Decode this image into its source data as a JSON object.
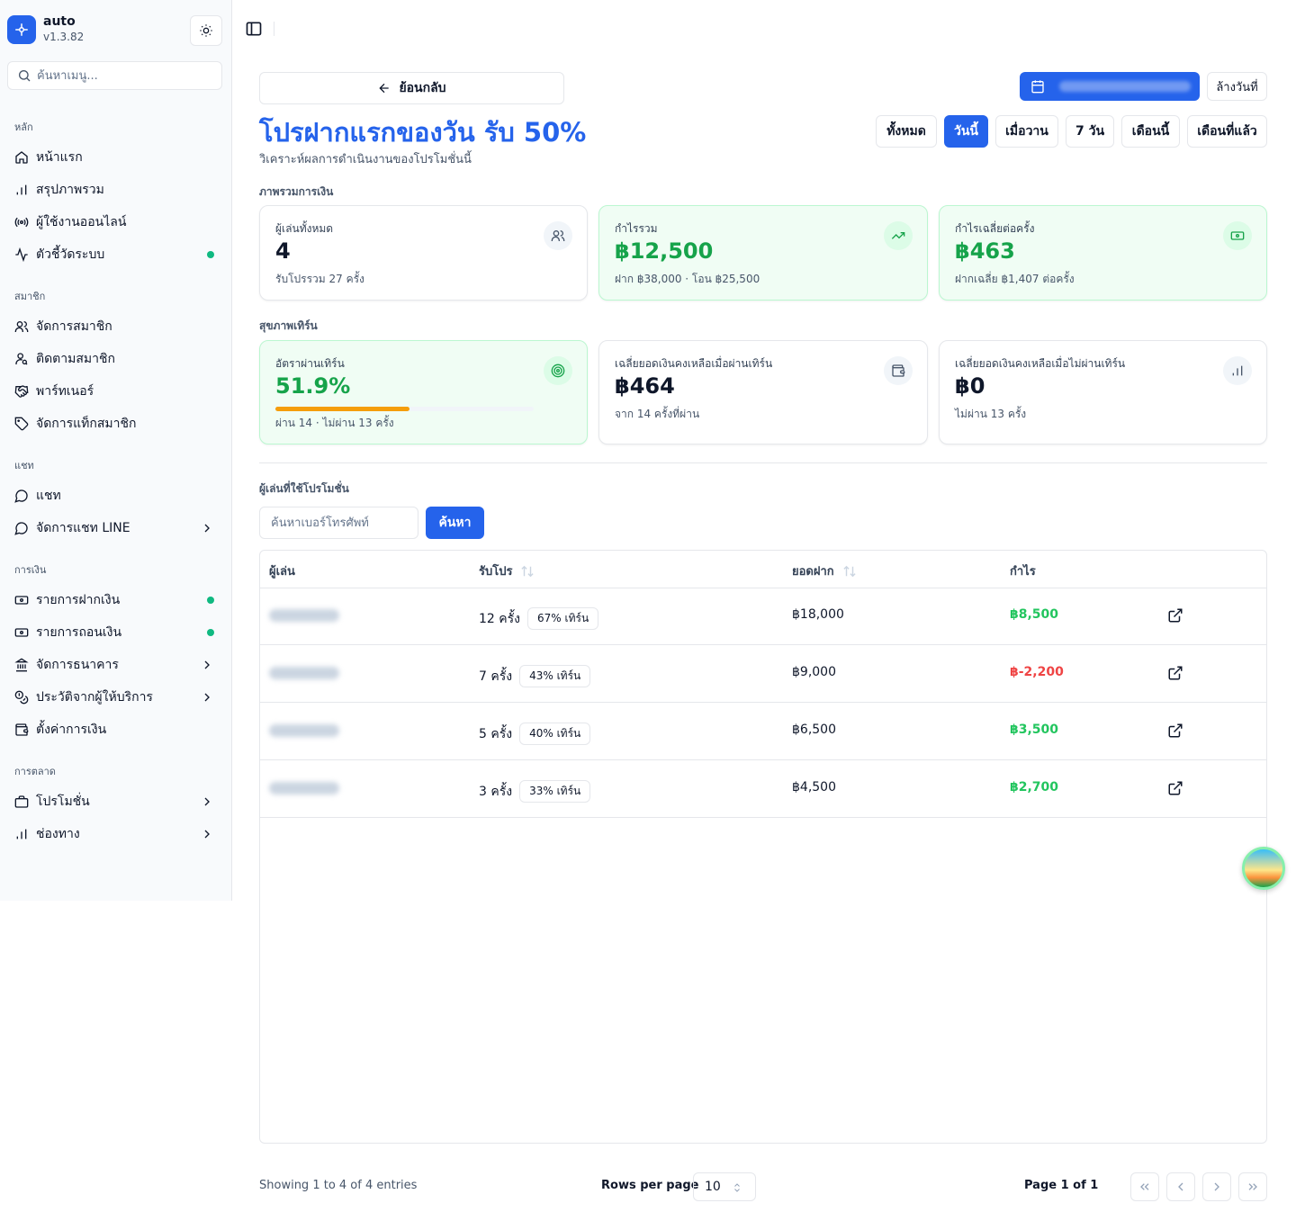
{
  "app": {
    "name": "auto",
    "version": "v1.3.82"
  },
  "sidebar": {
    "search_placeholder": "ค้นหาเมนู...",
    "groups": [
      {
        "label": "หลัก",
        "items": [
          {
            "label": "หน้าแรก",
            "icon": "home-icon"
          },
          {
            "label": "สรุปภาพรวม",
            "icon": "bar-chart-icon"
          },
          {
            "label": "ผู้ใช้งานออนไลน์",
            "icon": "radio-icon"
          },
          {
            "label": "ตัวชี้วัดระบบ",
            "icon": "activity-icon",
            "status_dot": true
          }
        ]
      },
      {
        "label": "สมาชิก",
        "items": [
          {
            "label": "จัดการสมาชิก",
            "icon": "users-icon"
          },
          {
            "label": "ติดตามสมาชิก",
            "icon": "user-search-icon"
          },
          {
            "label": "พาร์ทเนอร์",
            "icon": "handshake-icon"
          },
          {
            "label": "จัดการแท็กสมาชิก",
            "icon": "tag-icon"
          }
        ]
      },
      {
        "label": "แชท",
        "items": [
          {
            "label": "แชท",
            "icon": "message-circle-icon"
          },
          {
            "label": "จัดการแชท LINE",
            "icon": "message-circle-icon",
            "chevron": true
          }
        ]
      },
      {
        "label": "การเงิน",
        "items": [
          {
            "label": "รายการฝากเงิน",
            "icon": "deposit-icon",
            "status_dot": true
          },
          {
            "label": "รายการถอนเงิน",
            "icon": "withdraw-icon",
            "status_dot": true
          },
          {
            "label": "จัดการธนาคาร",
            "icon": "bank-icon",
            "chevron": true
          },
          {
            "label": "ประวัติจากผู้ให้บริการ",
            "icon": "coins-icon",
            "chevron": true
          },
          {
            "label": "ตั้งค่าการเงิน",
            "icon": "wallet-icon"
          }
        ]
      },
      {
        "label": "การตลาด",
        "items": [
          {
            "label": "โปรโมชั่น",
            "icon": "briefcase-icon",
            "chevron": true
          },
          {
            "label": "ช่องทาง",
            "icon": "bar-chart-icon",
            "chevron": true
          }
        ]
      }
    ]
  },
  "header": {
    "back_label": "ย้อนกลับ",
    "clear_date_label": "ล้างวันที่",
    "title": "โปรฝากแรกของวัน รับ 50%",
    "subtitle": "วิเคราะห์ผลการดำเนินงานของโปรโมชั่นนี้",
    "ranges": [
      "ทั้งหมด",
      "วันนี้",
      "เมื่อวาน",
      "7 วัน",
      "เดือนนี้",
      "เดือนที่แล้ว"
    ],
    "active_range": "วันนี้"
  },
  "finance": {
    "section_label": "ภาพรวมการเงิน",
    "cards": [
      {
        "label": "ผู้เล่นทั้งหมด",
        "value": "4",
        "foot": "รับโปรรวม 27 ครั้ง",
        "icon": "users-icon"
      },
      {
        "label": "กำไรรวม",
        "value": "฿12,500",
        "foot": "ฝาก ฿38,000 · โอน ฿25,500",
        "icon": "trending-up-icon"
      },
      {
        "label": "กำไรเฉลี่ยต่อครั้ง",
        "value": "฿463",
        "foot": "ฝากเฉลี่ย ฿1,407 ต่อครั้ง",
        "icon": "banknote-icon"
      }
    ]
  },
  "turnover": {
    "section_label": "สุขภาพเทิร์น",
    "cards": [
      {
        "label": "อัตราผ่านเทิร์น",
        "value": "51.9%",
        "foot": "ผ่าน 14 · ไม่ผ่าน 13 ครั้ง",
        "progress": 0.519,
        "icon": "target-icon"
      },
      {
        "label": "เฉลี่ยยอดเงินคงเหลือเมื่อผ่านเทิร์น",
        "value": "฿464",
        "foot": "จาก 14 ครั้งที่ผ่าน",
        "icon": "wallet-icon"
      },
      {
        "label": "เฉลี่ยยอดเงินคงเหลือเมื่อไม่ผ่านเทิร์น",
        "value": "฿0",
        "foot": "ไม่ผ่าน 13 ครั้ง",
        "icon": "bar-chart-icon"
      }
    ]
  },
  "players": {
    "section_label": "ผู้เล่นที่ใช้โปรโมชั่น",
    "search_placeholder": "ค้นหาเบอร์โทรศัพท์",
    "search_button": "ค้นหา",
    "columns": [
      "ผู้เล่น",
      "รับโปร",
      "ยอดฝาก",
      "กำไร"
    ],
    "rows": [
      {
        "times": "12 ครั้ง",
        "turn": "67% เทิร์น",
        "deposit": "฿18,000",
        "profit": "฿8,500",
        "positive": true
      },
      {
        "times": "7 ครั้ง",
        "turn": "43% เทิร์น",
        "deposit": "฿9,000",
        "profit": "฿-2,200",
        "positive": false
      },
      {
        "times": "5 ครั้ง",
        "turn": "40% เทิร์น",
        "deposit": "฿6,500",
        "profit": "฿3,500",
        "positive": true
      },
      {
        "times": "3 ครั้ง",
        "turn": "33% เทิร์น",
        "deposit": "฿4,500",
        "profit": "฿2,700",
        "positive": true
      }
    ]
  },
  "pagination": {
    "showing": "Showing 1 to 4 of 4 entries",
    "rows_per_page_label": "Rows per page",
    "rows_per_page": "10",
    "page_label": "Page 1 of 1"
  },
  "colors": {
    "accent": "#2563eb",
    "positive": "#22c55e",
    "negative": "#ef4444",
    "progress": "#f59e0b"
  }
}
